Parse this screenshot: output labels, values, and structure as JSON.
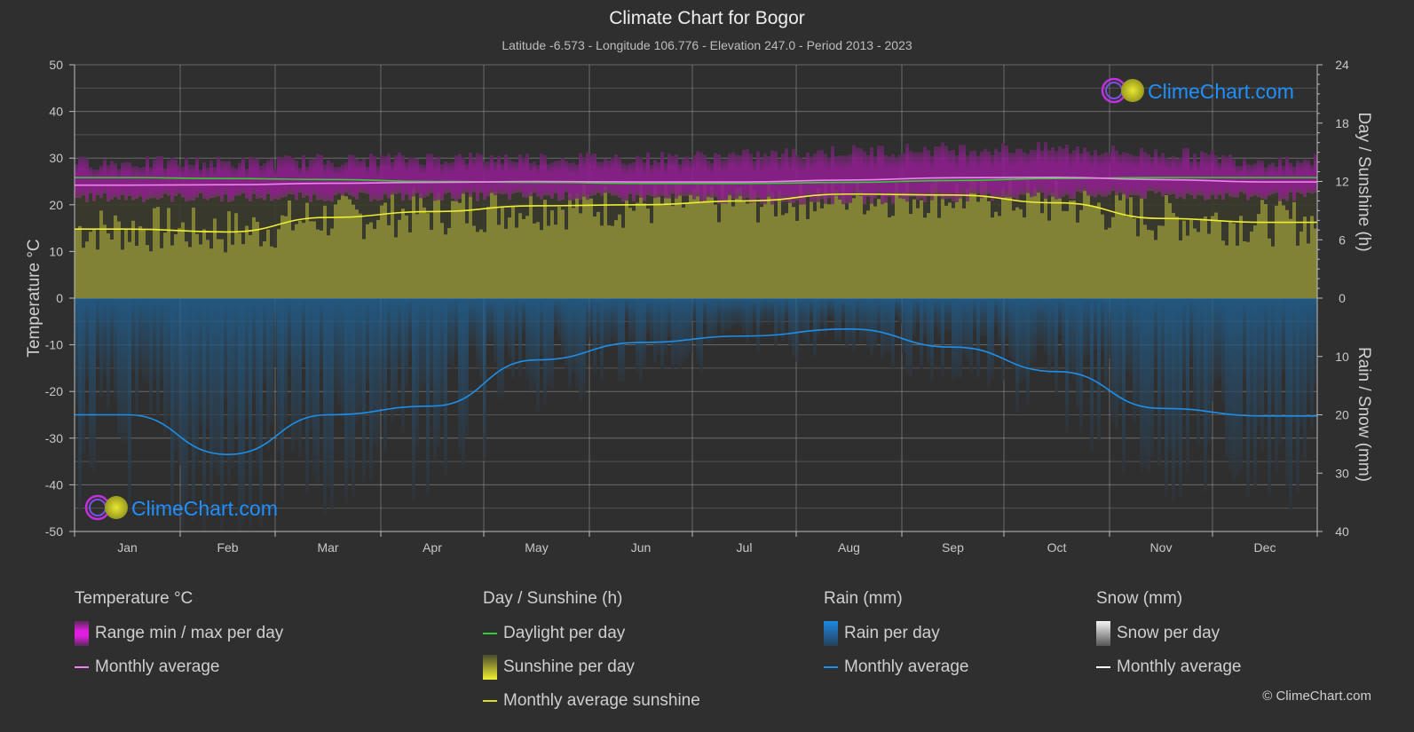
{
  "header": {
    "title": "Climate Chart for Bogor",
    "subtitle": "Latitude -6.573 - Longitude 106.776 - Elevation 247.0 - Period 2013 - 2023"
  },
  "watermark": {
    "text": "ClimeChart.com"
  },
  "copyright": "© ClimeChart.com",
  "colors": {
    "background": "#2f2f2f",
    "temp_range": "#c21fc2",
    "temp_avg": "#ee82ee",
    "daylight": "#33cc33",
    "sunshine_fill": "#8f8f38",
    "sunshine_avg": "#eeee33",
    "rain_fill": "#1f5f8f",
    "rain_avg": "#1e8fe8",
    "snow_avg": "#ffffff",
    "brand": "#1e90ff"
  },
  "chart_data": {
    "type": "area",
    "title": "Climate Chart for Bogor",
    "categories": [
      "Jan",
      "Feb",
      "Mar",
      "Apr",
      "May",
      "Jun",
      "Jul",
      "Aug",
      "Sep",
      "Oct",
      "Nov",
      "Dec"
    ],
    "axes": {
      "left": {
        "label": "Temperature °C",
        "ylim": [
          -50,
          50
        ],
        "ticks": [
          "50",
          "40",
          "30",
          "20",
          "10",
          "0",
          "-10",
          "-20",
          "-30",
          "-40",
          "-50"
        ]
      },
      "right_top": {
        "label": "Day / Sunshine (h)",
        "ylim": [
          0,
          24
        ],
        "ticks": [
          "24",
          "18",
          "12",
          "6",
          "0"
        ]
      },
      "right_bottom": {
        "label": "Rain / Snow (mm)",
        "ylim": [
          0,
          40
        ],
        "ticks": [
          "0",
          "10",
          "20",
          "30",
          "40"
        ]
      }
    },
    "grid": true,
    "series": [
      {
        "name": "Temperature monthly average",
        "axis": "left",
        "values": [
          24.2,
          24.3,
          24.6,
          24.8,
          25.0,
          24.9,
          24.9,
          25.3,
          25.8,
          25.9,
          25.4,
          24.9
        ]
      },
      {
        "name": "Temperature range min",
        "axis": "left",
        "values": [
          21.5,
          21.5,
          21.6,
          21.7,
          21.8,
          21.5,
          21.0,
          21.0,
          21.5,
          22.0,
          22.0,
          21.7
        ]
      },
      {
        "name": "Temperature range max",
        "axis": "left",
        "values": [
          29.0,
          29.0,
          29.5,
          30.0,
          30.0,
          30.0,
          30.5,
          31.5,
          32.0,
          32.0,
          31.0,
          29.5
        ]
      },
      {
        "name": "Daylight per day",
        "axis": "right_top",
        "values": [
          12.4,
          12.3,
          12.2,
          12.0,
          11.9,
          11.8,
          11.8,
          11.9,
          12.1,
          12.3,
          12.4,
          12.4
        ]
      },
      {
        "name": "Monthly average sunshine",
        "axis": "right_top",
        "values": [
          7.1,
          6.8,
          8.3,
          8.9,
          9.5,
          9.6,
          10.0,
          10.7,
          10.6,
          9.8,
          8.2,
          7.8
        ]
      },
      {
        "name": "Rain monthly average",
        "axis": "right_bottom",
        "values": [
          20.0,
          26.8,
          20.0,
          18.5,
          10.6,
          7.6,
          6.5,
          5.3,
          8.4,
          12.6,
          18.9,
          20.2
        ]
      },
      {
        "name": "Snow monthly average",
        "axis": "right_bottom",
        "values": [
          0,
          0,
          0,
          0,
          0,
          0,
          0,
          0,
          0,
          0,
          0,
          0
        ]
      }
    ]
  },
  "legend": {
    "groups": [
      {
        "title": "Temperature °C",
        "items": [
          {
            "label": "Range min / max per day",
            "kind": "box",
            "color": "#e01ee0"
          },
          {
            "label": "Monthly average",
            "kind": "line",
            "color": "#ee82ee"
          }
        ]
      },
      {
        "title": "Day / Sunshine (h)",
        "items": [
          {
            "label": "Daylight per day",
            "kind": "line",
            "color": "#33cc33"
          },
          {
            "label": "Sunshine per day",
            "kind": "box",
            "color": "#e0e02a"
          },
          {
            "label": "Monthly average sunshine",
            "kind": "line",
            "color": "#dddd22"
          }
        ]
      },
      {
        "title": "Rain (mm)",
        "items": [
          {
            "label": "Rain per day",
            "kind": "box",
            "color": "#1e88e5"
          },
          {
            "label": "Monthly average",
            "kind": "line",
            "color": "#1e8fe8"
          }
        ]
      },
      {
        "title": "Snow (mm)",
        "items": [
          {
            "label": "Snow per day",
            "kind": "box",
            "color": "#e0e0e0"
          },
          {
            "label": "Monthly average",
            "kind": "line",
            "color": "#ffffff"
          }
        ]
      }
    ]
  }
}
